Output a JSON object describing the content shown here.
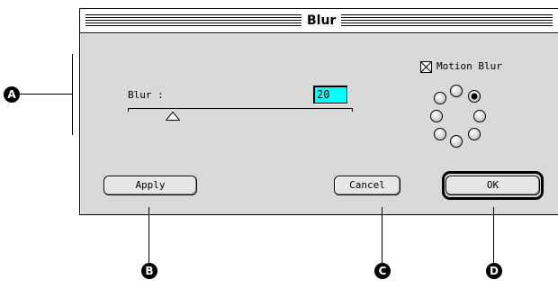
{
  "dialog": {
    "title": "Blur",
    "blur_label": "Blur :",
    "blur_value": "20",
    "motion_blur": {
      "label": "Motion Blur",
      "checked": true
    },
    "direction_selected_index": 1
  },
  "buttons": {
    "apply": "Apply",
    "cancel": "Cancel",
    "ok": "OK"
  },
  "callouts": {
    "a": "A",
    "b": "B",
    "c": "C",
    "d": "D"
  },
  "colors": {
    "dialog_bg": "#d9d9d9",
    "input_bg": "#00ffff",
    "callout": "#000000"
  }
}
